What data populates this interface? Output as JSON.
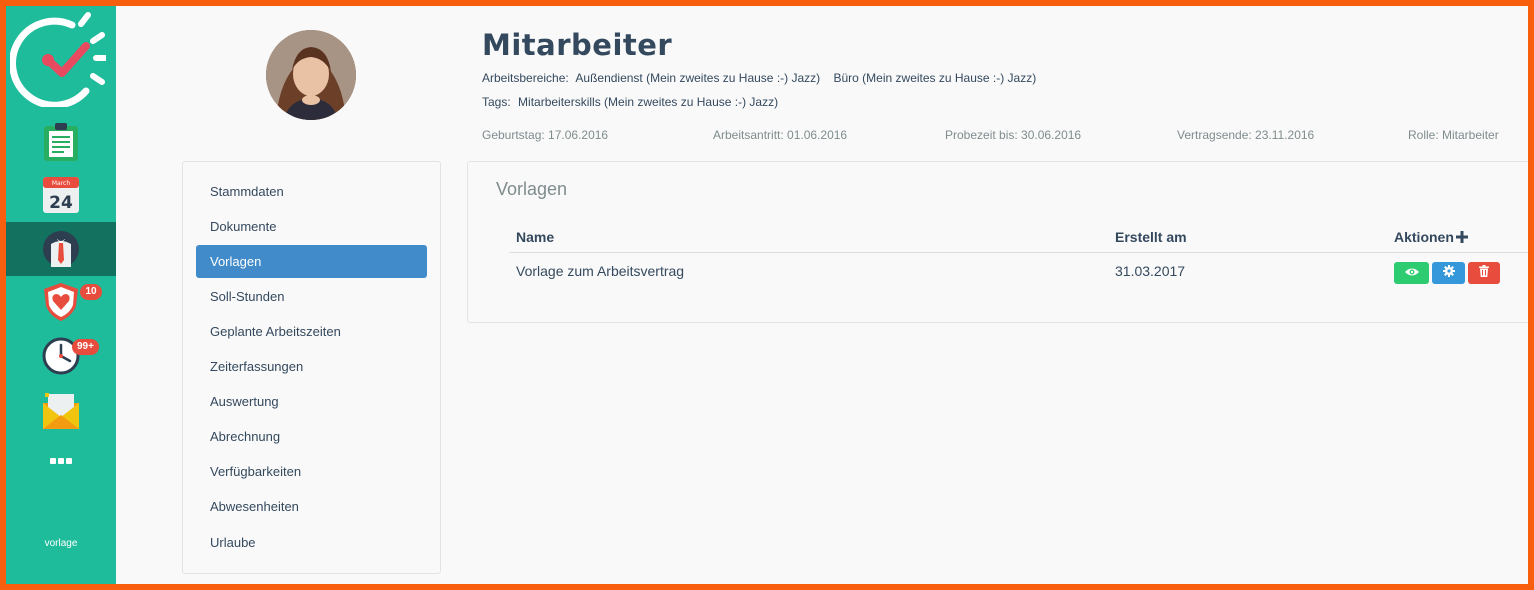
{
  "sidebar": {
    "items": [
      {
        "name": "clipboard-icon"
      },
      {
        "name": "calendar-icon",
        "month": "March",
        "day": "24"
      },
      {
        "name": "employee-icon",
        "active": true
      },
      {
        "name": "heart-shield-icon",
        "badge": "10"
      },
      {
        "name": "clock-icon",
        "badge": "99+"
      },
      {
        "name": "mail-icon"
      },
      {
        "name": "more-icon"
      }
    ],
    "footer": "vorlage"
  },
  "header": {
    "title": "Mitarbeiter",
    "arbeitsbereiche_label": "Arbeitsbereiche:",
    "arbeitsbereiche": [
      "Außendienst (Mein zweites zu Hause :-) Jazz)",
      "Büro (Mein zweites zu Hause :-) Jazz)"
    ],
    "tags_label": "Tags:",
    "tags": [
      "Mitarbeiterskills (Mein zweites zu Hause :-) Jazz)"
    ],
    "facts": {
      "geburtstag": "Geburtstag: 17.06.2016",
      "arbeitsantritt": "Arbeitsantritt: 01.06.2016",
      "probezeit": "Probezeit bis: 30.06.2016",
      "vertragsende": "Vertragsende: 23.11.2016",
      "rolle": "Rolle: Mitarbeiter"
    }
  },
  "subnav": {
    "items": [
      {
        "label": "Stammdaten"
      },
      {
        "label": "Dokumente"
      },
      {
        "label": "Vorlagen",
        "active": true
      },
      {
        "label": "Soll-Stunden"
      },
      {
        "label": "Geplante Arbeitszeiten"
      },
      {
        "label": "Zeiterfassungen"
      },
      {
        "label": "Auswertung"
      },
      {
        "label": "Abrechnung"
      },
      {
        "label": "Verfügbarkeiten"
      },
      {
        "label": "Abwesenheiten"
      },
      {
        "label": "Urlaube"
      }
    ]
  },
  "panel": {
    "title": "Vorlagen",
    "columns": {
      "name": "Name",
      "created": "Erstellt am",
      "actions": "Aktionen"
    },
    "rows": [
      {
        "name": "Vorlage zum Arbeitsvertrag",
        "created": "31.03.2017"
      }
    ]
  },
  "colors": {
    "sidebar": "#1fbc9c",
    "sidebar_active": "#13725f",
    "accent": "#428bca",
    "success": "#2ecc71",
    "info": "#3498db",
    "danger": "#e74c3c",
    "frame": "#f75f0f"
  }
}
